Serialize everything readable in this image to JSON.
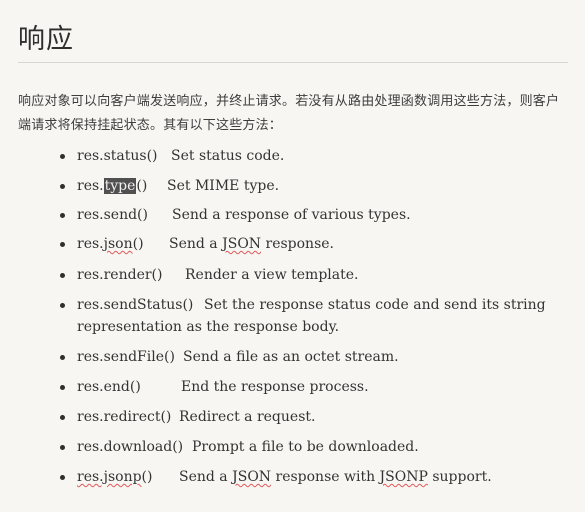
{
  "section": {
    "title": "响应",
    "intro": "响应对象可以向客户端发送响应，并终止请求。若没有从路由处理函数调用这些方法，则客户端请求将保持挂起状态。其有以下这些方法："
  },
  "methods": [
    {
      "name": "res.status()",
      "description": "Set status code."
    },
    {
      "name_prefix": "res.",
      "name_highlight": "type",
      "name_suffix": "()",
      "description": "Set MIME type."
    },
    {
      "name": "res.send()",
      "description": "Send a response of various types."
    },
    {
      "name_prefix": "res.",
      "name_spell": "json",
      "name_suffix": "()",
      "description_prefix": "Send a ",
      "description_spell": "JSON",
      "description_suffix": " response."
    },
    {
      "name": "res.render()",
      "description": "Render a view template."
    },
    {
      "name": "res.sendStatus()",
      "description_line1": "Set the response status code and send its string",
      "description_line2": "representation as the response body."
    },
    {
      "name": "res.sendFile()",
      "description": "Send a file as an octet stream."
    },
    {
      "name": "res.end()",
      "description": "End the response process."
    },
    {
      "name": "res.redirect()",
      "description": "Redirect a request."
    },
    {
      "name": "res.download()",
      "description": "Prompt a file to be downloaded."
    },
    {
      "name_spell": "res.jsonp",
      "name_suffix": "()",
      "description_prefix": "Send a ",
      "description_spell": "JSON",
      "description_middle": " response with ",
      "description_spell2": "JSONP",
      "description_suffix": " support."
    }
  ]
}
